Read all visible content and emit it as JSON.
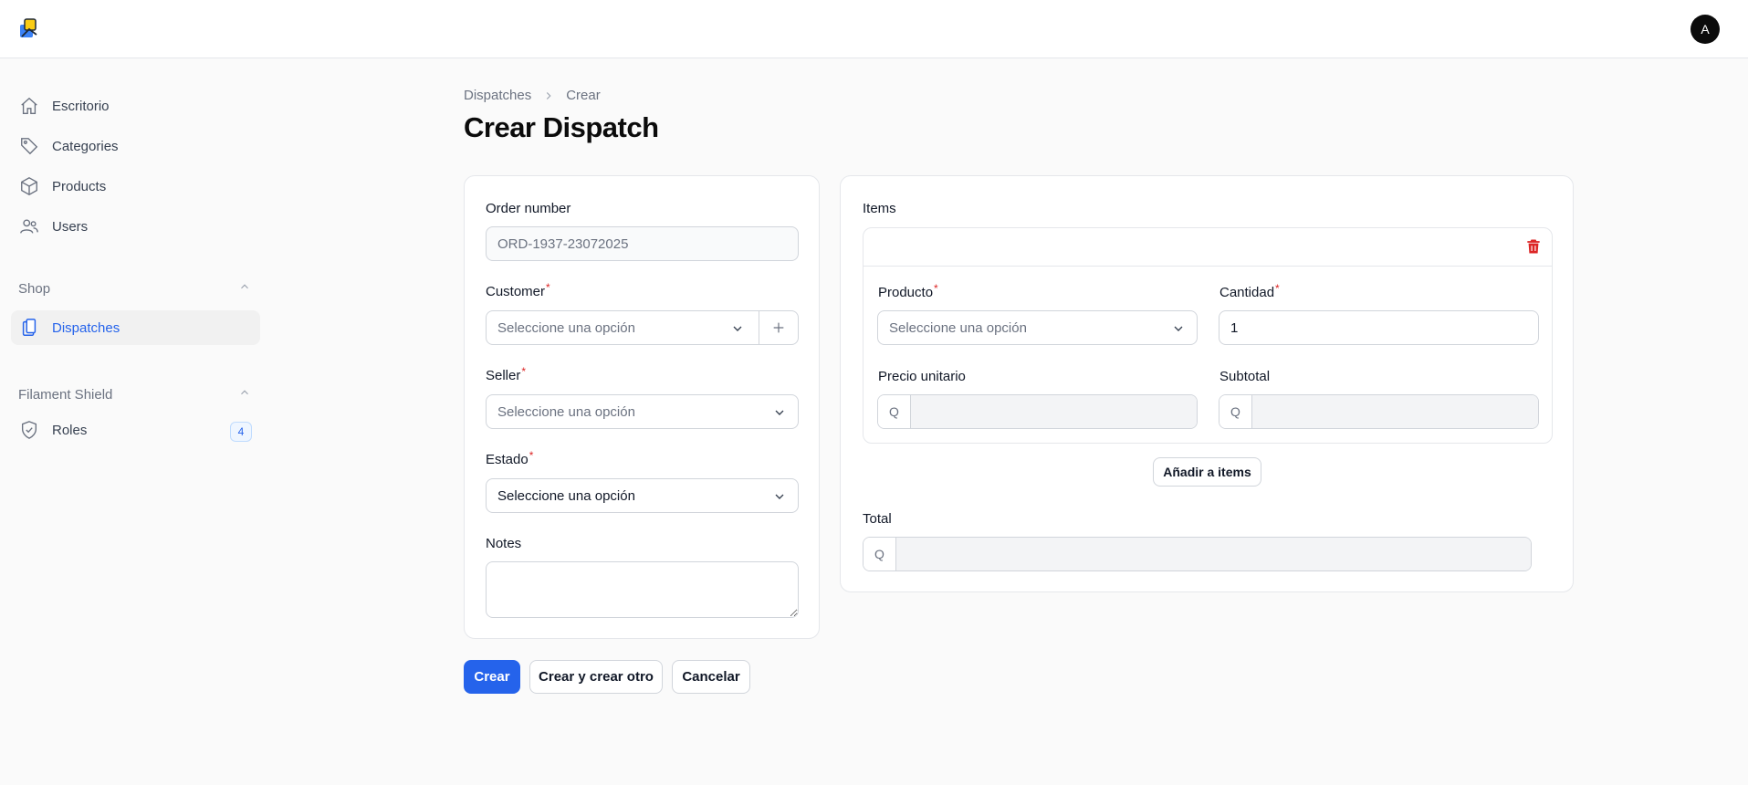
{
  "header": {
    "logo_icon": "app-logo-icon",
    "avatar_initial": "A"
  },
  "sidebar": {
    "items": [
      {
        "label": "Escritorio",
        "icon": "home-icon"
      },
      {
        "label": "Categories",
        "icon": "tag-icon"
      },
      {
        "label": "Products",
        "icon": "cube-icon"
      },
      {
        "label": "Users",
        "icon": "users-icon"
      }
    ],
    "groups": [
      {
        "label": "Shop",
        "items": [
          {
            "label": "Dispatches",
            "icon": "clipboard-icon",
            "active": true
          }
        ]
      },
      {
        "label": "Filament Shield",
        "items": [
          {
            "label": "Roles",
            "icon": "shield-icon",
            "badge": "4"
          }
        ]
      }
    ]
  },
  "breadcrumb": {
    "parent": "Dispatches",
    "current": "Crear"
  },
  "page_title": "Crear Dispatch",
  "form": {
    "order_number": {
      "label": "Order number",
      "value": "ORD-1937-23072025"
    },
    "customer": {
      "label": "Customer",
      "placeholder": "Seleccione una opción"
    },
    "seller": {
      "label": "Seller",
      "placeholder": "Seleccione una opción"
    },
    "estado": {
      "label": "Estado",
      "value": "Seleccione una opción"
    },
    "notes": {
      "label": "Notes",
      "value": ""
    }
  },
  "items": {
    "label": "Items",
    "producto": {
      "label": "Producto",
      "placeholder": "Seleccione una opción"
    },
    "cantidad": {
      "label": "Cantidad",
      "value": "1"
    },
    "precio_unitario": {
      "label": "Precio unitario",
      "prefix": "Q",
      "value": ""
    },
    "subtotal": {
      "label": "Subtotal",
      "prefix": "Q",
      "value": ""
    },
    "add_button": "Añadir a items",
    "total": {
      "label": "Total",
      "prefix": "Q",
      "value": ""
    }
  },
  "actions": {
    "create": "Crear",
    "create_another": "Crear y crear otro",
    "cancel": "Cancelar"
  },
  "colors": {
    "primary": "#2563eb",
    "danger": "#dc2626",
    "required": "#dc2626"
  }
}
